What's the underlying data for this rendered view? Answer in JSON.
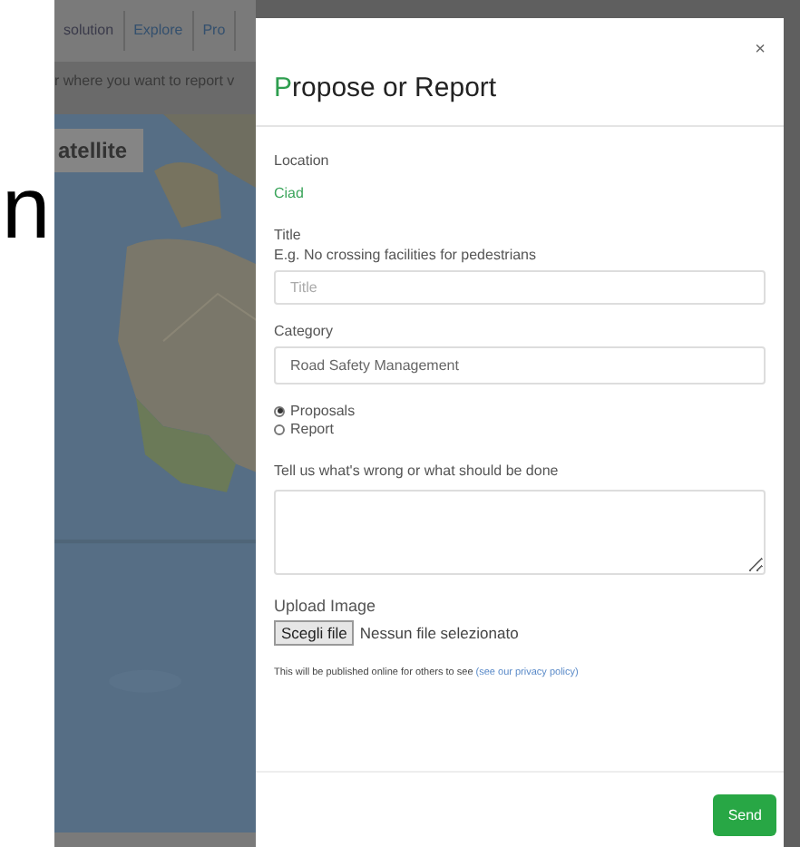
{
  "background": {
    "tabs": [
      {
        "label": "solution"
      },
      {
        "label": "Explore"
      },
      {
        "label": "Pro"
      }
    ],
    "instruction": "r where you want to report v",
    "map_button": "atellite",
    "fragment": "n"
  },
  "dialog": {
    "title": "Propose or Report",
    "close": "×",
    "location": {
      "label": "Location",
      "value": "Ciad"
    },
    "title_field": {
      "label": "Title",
      "hint": "E.g. No crossing facilities for pedestrians",
      "placeholder": "Title"
    },
    "category": {
      "label": "Category",
      "value": "Road Safety Management"
    },
    "types": [
      {
        "label": "Proposals",
        "selected": true
      },
      {
        "label": "Report",
        "selected": false
      }
    ],
    "description": {
      "label": "Tell us what's wrong or what should be done"
    },
    "upload": {
      "label": "Upload Image",
      "button": "Scegli file",
      "status": "Nessun file selezionato"
    },
    "privacy": {
      "text": "This will be published online for others to see",
      "link": "(see our privacy policy)"
    },
    "send": "Send"
  }
}
